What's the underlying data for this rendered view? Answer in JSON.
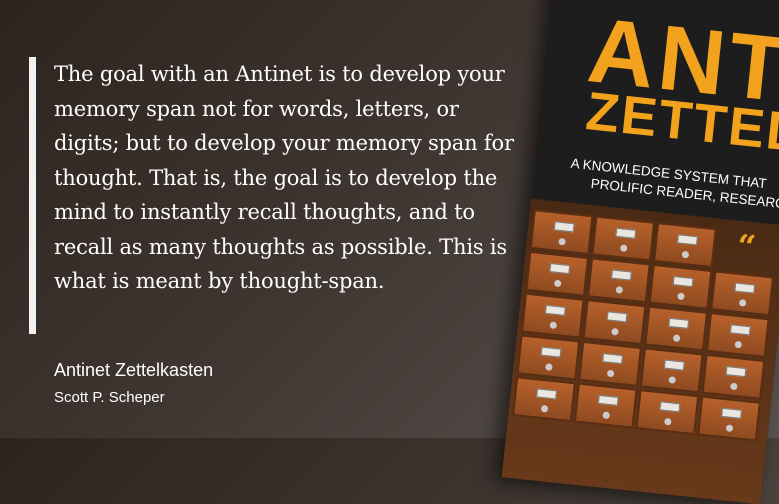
{
  "quote": {
    "text": "The goal with an Antinet is to develop your memory span not for words, letters, or digits; but to develop your memory span for thought. That is, the goal is to develop the mind to instantly recall thoughts, and to recall as many thoughts as possible. This is what is meant by thought-span.",
    "source_title": "Antinet Zettelkasten",
    "author": "Scott P. Scheper"
  },
  "book_cover": {
    "title": "ANTINET",
    "subtitle": "ZETTELKASTEN",
    "tagline_line1": "A knowledge system that",
    "tagline_line2": "prolific reader, research"
  },
  "colors": {
    "accent": "#f2a21c",
    "quote_bar": "#f2f2f2",
    "text": "#ffffff"
  }
}
